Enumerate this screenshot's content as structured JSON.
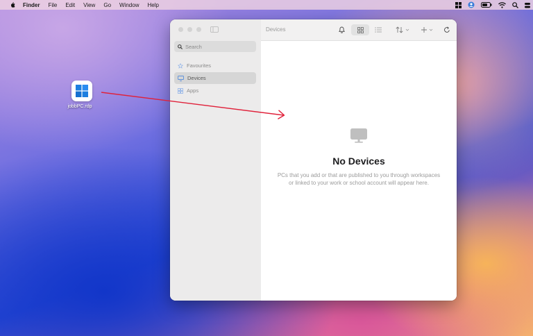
{
  "menubar": {
    "app_name": "Finder",
    "items": [
      "File",
      "Edit",
      "View",
      "Go",
      "Window",
      "Help"
    ]
  },
  "desktop": {
    "file_name": "jobbPC.rdp"
  },
  "window": {
    "sidebar": {
      "search_placeholder": "Search",
      "items": [
        {
          "label": "Favourites",
          "icon": "star-icon",
          "active": false
        },
        {
          "label": "Devices",
          "icon": "monitor-icon",
          "active": true
        },
        {
          "label": "Apps",
          "icon": "apps-grid-icon",
          "active": false
        }
      ]
    },
    "toolbar": {
      "title": "Devices"
    },
    "empty_state": {
      "title": "No Devices",
      "description": "PCs that you add or that are published to you through workspaces or linked to your work or school account will appear here."
    }
  },
  "annotation_color": "#e0213a"
}
